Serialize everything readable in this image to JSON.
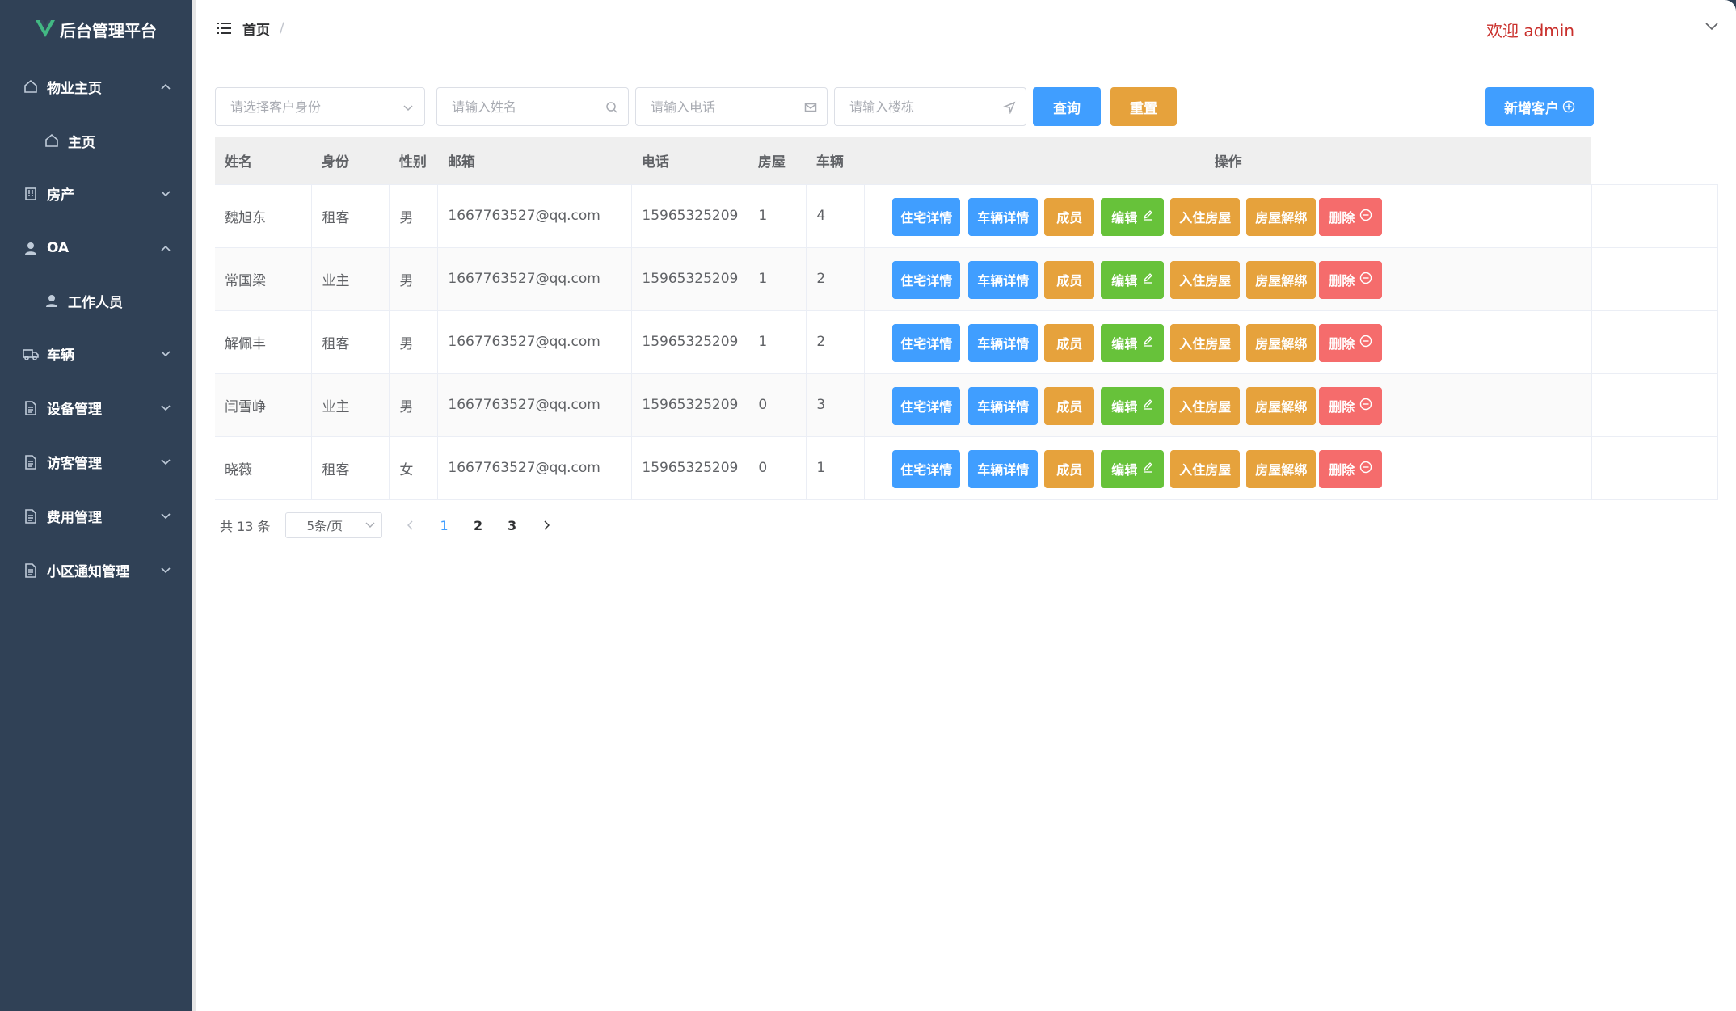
{
  "app": {
    "title": "后台管理平台"
  },
  "sidebar": {
    "items": [
      {
        "label": "物业主页",
        "icon": "home-icon",
        "expanded": true
      },
      {
        "label": "主页",
        "icon": "home-icon",
        "sub": true
      },
      {
        "label": "房产",
        "icon": "building-icon",
        "expanded": false
      },
      {
        "label": "OA",
        "icon": "user-icon",
        "expanded": true
      },
      {
        "label": "工作人员",
        "icon": "user-icon",
        "sub": true
      },
      {
        "label": "车辆",
        "icon": "truck-icon",
        "expanded": false
      },
      {
        "label": "设备管理",
        "icon": "document-icon",
        "expanded": false
      },
      {
        "label": "访客管理",
        "icon": "document-icon",
        "expanded": false
      },
      {
        "label": "费用管理",
        "icon": "document-icon",
        "expanded": false
      },
      {
        "label": "小区通知管理",
        "icon": "document-icon",
        "expanded": false
      }
    ]
  },
  "header": {
    "breadcrumb": "首页",
    "separator": "/",
    "welcome": "欢迎 admin"
  },
  "filters": {
    "identity_placeholder": "请选择客户身份",
    "name_placeholder": "请输入姓名",
    "phone_placeholder": "请输入电话",
    "building_placeholder": "请输入楼栋",
    "query_label": "查询",
    "reset_label": "重置",
    "add_label": "新增客户"
  },
  "table": {
    "columns": [
      "姓名",
      "身份",
      "性别",
      "邮箱",
      "电话",
      "房屋",
      "车辆",
      "操作"
    ],
    "rows": [
      {
        "name": "魏旭东",
        "identity": "租客",
        "gender": "男",
        "email": "1667763527@qq.com",
        "phone": "15965325209",
        "houses": "1",
        "vehicles": "4"
      },
      {
        "name": "常国梁",
        "identity": "业主",
        "gender": "男",
        "email": "1667763527@qq.com",
        "phone": "15965325209",
        "houses": "1",
        "vehicles": "2"
      },
      {
        "name": "解佩丰",
        "identity": "租客",
        "gender": "男",
        "email": "1667763527@qq.com",
        "phone": "15965325209",
        "houses": "1",
        "vehicles": "2"
      },
      {
        "name": "闫雪峥",
        "identity": "业主",
        "gender": "男",
        "email": "1667763527@qq.com",
        "phone": "15965325209",
        "houses": "0",
        "vehicles": "3"
      },
      {
        "name": "晓薇",
        "identity": "租客",
        "gender": "女",
        "email": "1667763527@qq.com",
        "phone": "15965325209",
        "houses": "0",
        "vehicles": "1"
      }
    ],
    "actions": {
      "house_detail": "住宅详情",
      "vehicle_detail": "车辆详情",
      "members": "成员",
      "edit": "编辑",
      "move_in": "入住房屋",
      "unbind": "房屋解绑",
      "delete": "删除"
    }
  },
  "pagination": {
    "total": "共 13 条",
    "page_size": "5条/页",
    "pages": [
      "1",
      "2",
      "3"
    ],
    "current": "1"
  },
  "colors": {
    "sidebar_bg": "#304156",
    "primary": "#409eff",
    "warning": "#e6a23c",
    "success": "#67c23a",
    "danger": "#f56c6c",
    "welcome": "#c9302c"
  }
}
